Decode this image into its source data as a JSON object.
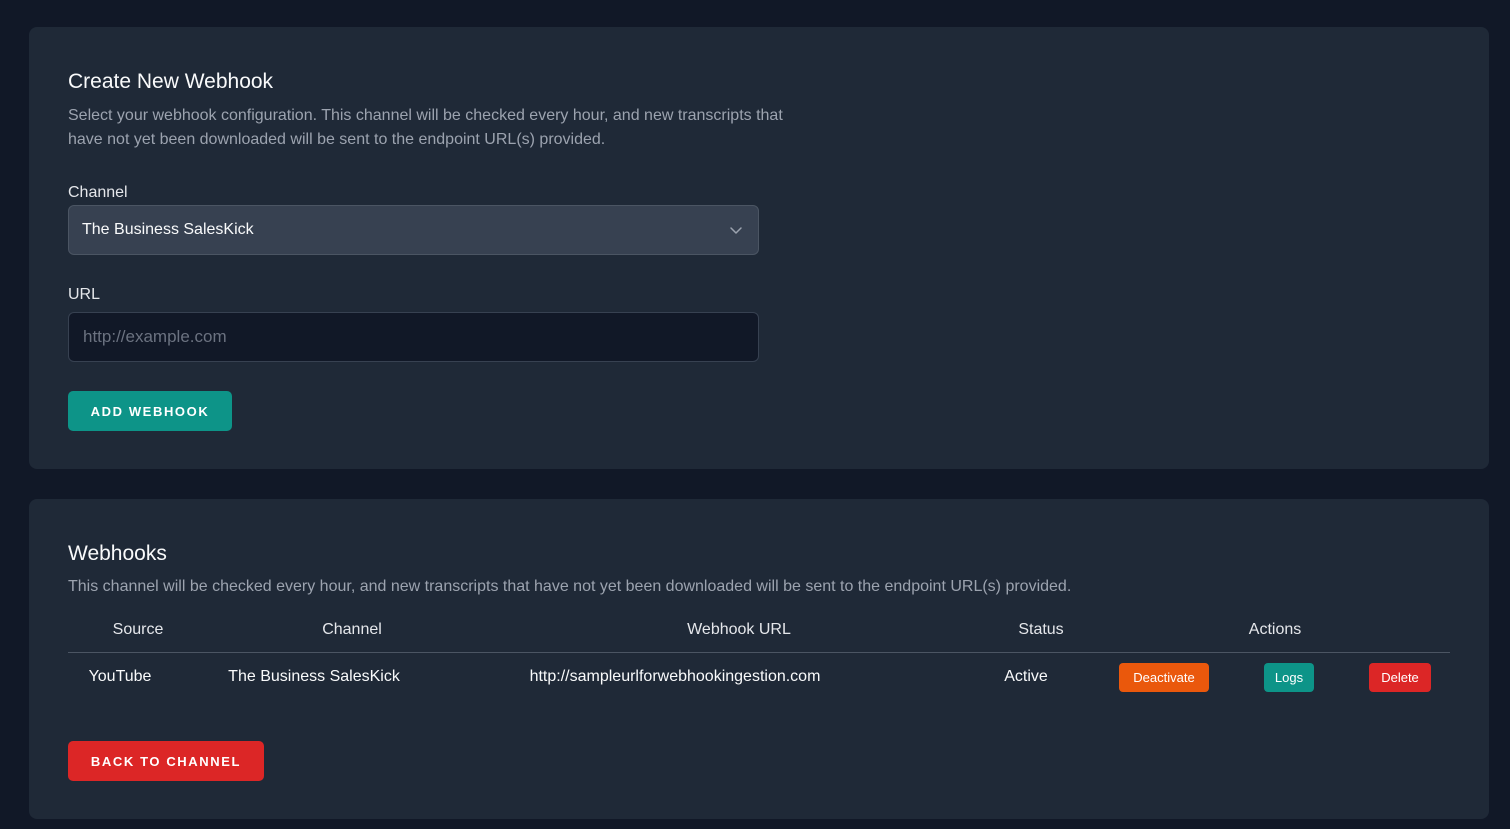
{
  "create": {
    "title": "Create New Webhook",
    "description": "Select your webhook configuration. This channel will be checked every hour, and new transcripts that have not yet been downloaded will be sent to the endpoint URL(s) provided.",
    "channel_label": "Channel",
    "channel_selected": "The Business SalesKick",
    "url_label": "URL",
    "url_value": "",
    "url_placeholder": "http://example.com",
    "add_button": "Add Webhook"
  },
  "list": {
    "title": "Webhooks",
    "description": "This channel will be checked every hour, and new transcripts that have not yet been downloaded will be sent to the endpoint URL(s) provided.",
    "columns": [
      "Source",
      "Channel",
      "Webhook URL",
      "Status",
      "Actions"
    ],
    "rows": [
      {
        "source": "YouTube",
        "channel": "The Business SalesKick",
        "url": "http://sampleurlforwebhookingestion.com",
        "status": "Active",
        "actions": {
          "deactivate": "Deactivate",
          "logs": "Logs",
          "delete": "Delete"
        }
      }
    ],
    "back_button": "Back to Channel"
  },
  "colors": {
    "background": "#111827",
    "card": "#1f2937",
    "primary": "#0d9488",
    "danger": "#dc2626",
    "warning": "#ea580c"
  },
  "icons": {
    "select_chevron": "chevron-down-icon"
  }
}
